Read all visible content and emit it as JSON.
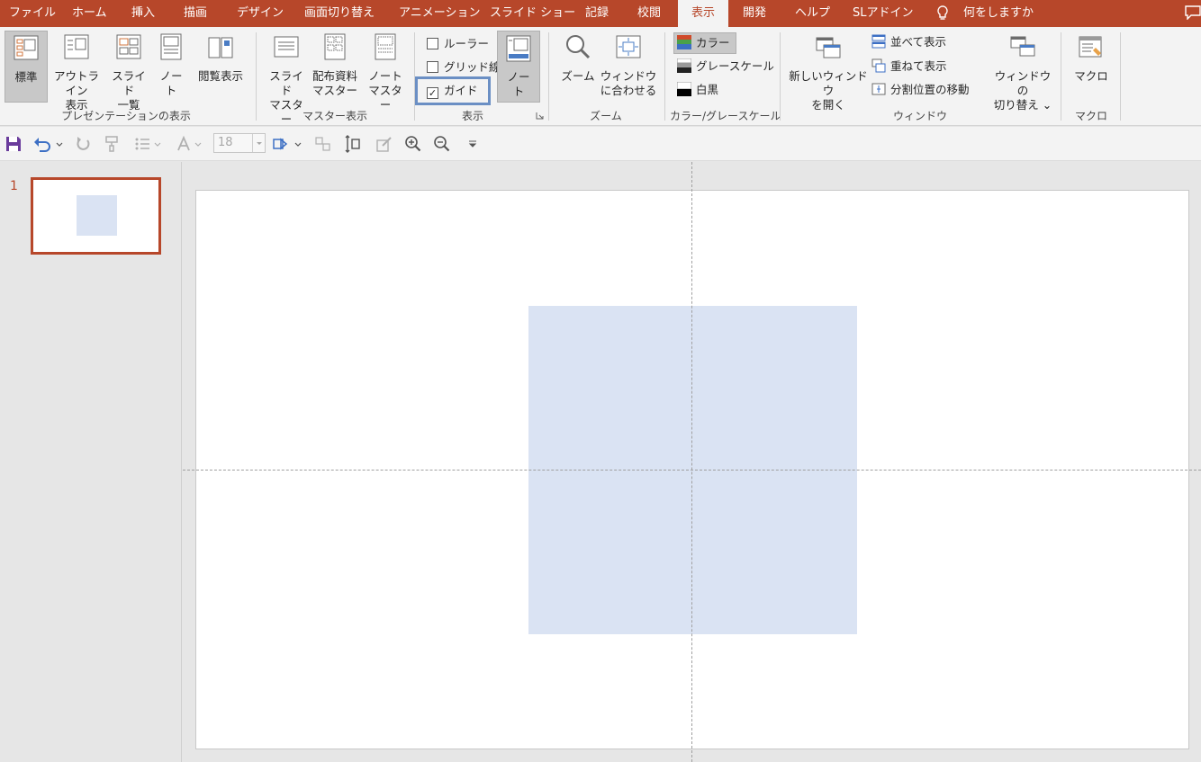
{
  "tabs": [
    {
      "label": "ファイル",
      "active": false
    },
    {
      "label": "ホーム",
      "active": false
    },
    {
      "label": "挿入",
      "active": false
    },
    {
      "label": "描画",
      "active": false
    },
    {
      "label": "デザイン",
      "active": false
    },
    {
      "label": "画面切り替え",
      "active": false
    },
    {
      "label": "アニメーション",
      "active": false
    },
    {
      "label": "スライド ショー",
      "active": false
    },
    {
      "label": "記録",
      "active": false
    },
    {
      "label": "校閲",
      "active": false
    },
    {
      "label": "表示",
      "active": true
    },
    {
      "label": "開発",
      "active": false
    },
    {
      "label": "ヘルプ",
      "active": false
    },
    {
      "label": "SLアドイン",
      "active": false
    }
  ],
  "tell_me": "何をしますか",
  "ribbon": {
    "presentation_views": {
      "label": "プレゼンテーションの表示",
      "normal": "標準",
      "outline": [
        "アウトライン",
        "表示"
      ],
      "slide_sorter": [
        "スライド",
        "一覧"
      ],
      "notes_page": [
        "ノー",
        "ト"
      ],
      "reading": "閲覧表示"
    },
    "master_views": {
      "label": "マスター表示",
      "slide_master": [
        "スライド",
        "マスター"
      ],
      "handout_master": [
        "配布資料",
        "マスター"
      ],
      "notes_master": [
        "ノート",
        "マスター"
      ]
    },
    "show": {
      "label": "表示",
      "ruler": {
        "label": "ルーラー",
        "checked": false
      },
      "gridlines": {
        "label": "グリッド線",
        "checked": false
      },
      "guides": {
        "label": "ガイド",
        "checked": true,
        "checkmark": "✓"
      },
      "notes": [
        "ノー",
        "ト"
      ]
    },
    "zoom": {
      "label": "ズーム",
      "zoom": "ズーム",
      "fit": [
        "ウィンドウ",
        "に合わせる"
      ]
    },
    "color": {
      "label": "カラー/グレースケール",
      "color": "カラー",
      "grayscale": "グレースケール",
      "bw": "白黒"
    },
    "window": {
      "label": "ウィンドウ",
      "new_window": [
        "新しいウィンドウ",
        "を開く"
      ],
      "arrange_all": "並べて表示",
      "cascade": "重ねて表示",
      "move_split": "分割位置の移動",
      "switch": [
        "ウィンドウの",
        "切り替え ⌄"
      ]
    },
    "macros": {
      "label": "マクロ",
      "macros": "マクロ"
    }
  },
  "qat": {
    "font_size": "18"
  },
  "slides": [
    {
      "number": "1"
    }
  ],
  "colors": {
    "accent": "#b7472a",
    "shape_fill": "#dae3f3",
    "guide_highlight": "#6b8fc4"
  }
}
